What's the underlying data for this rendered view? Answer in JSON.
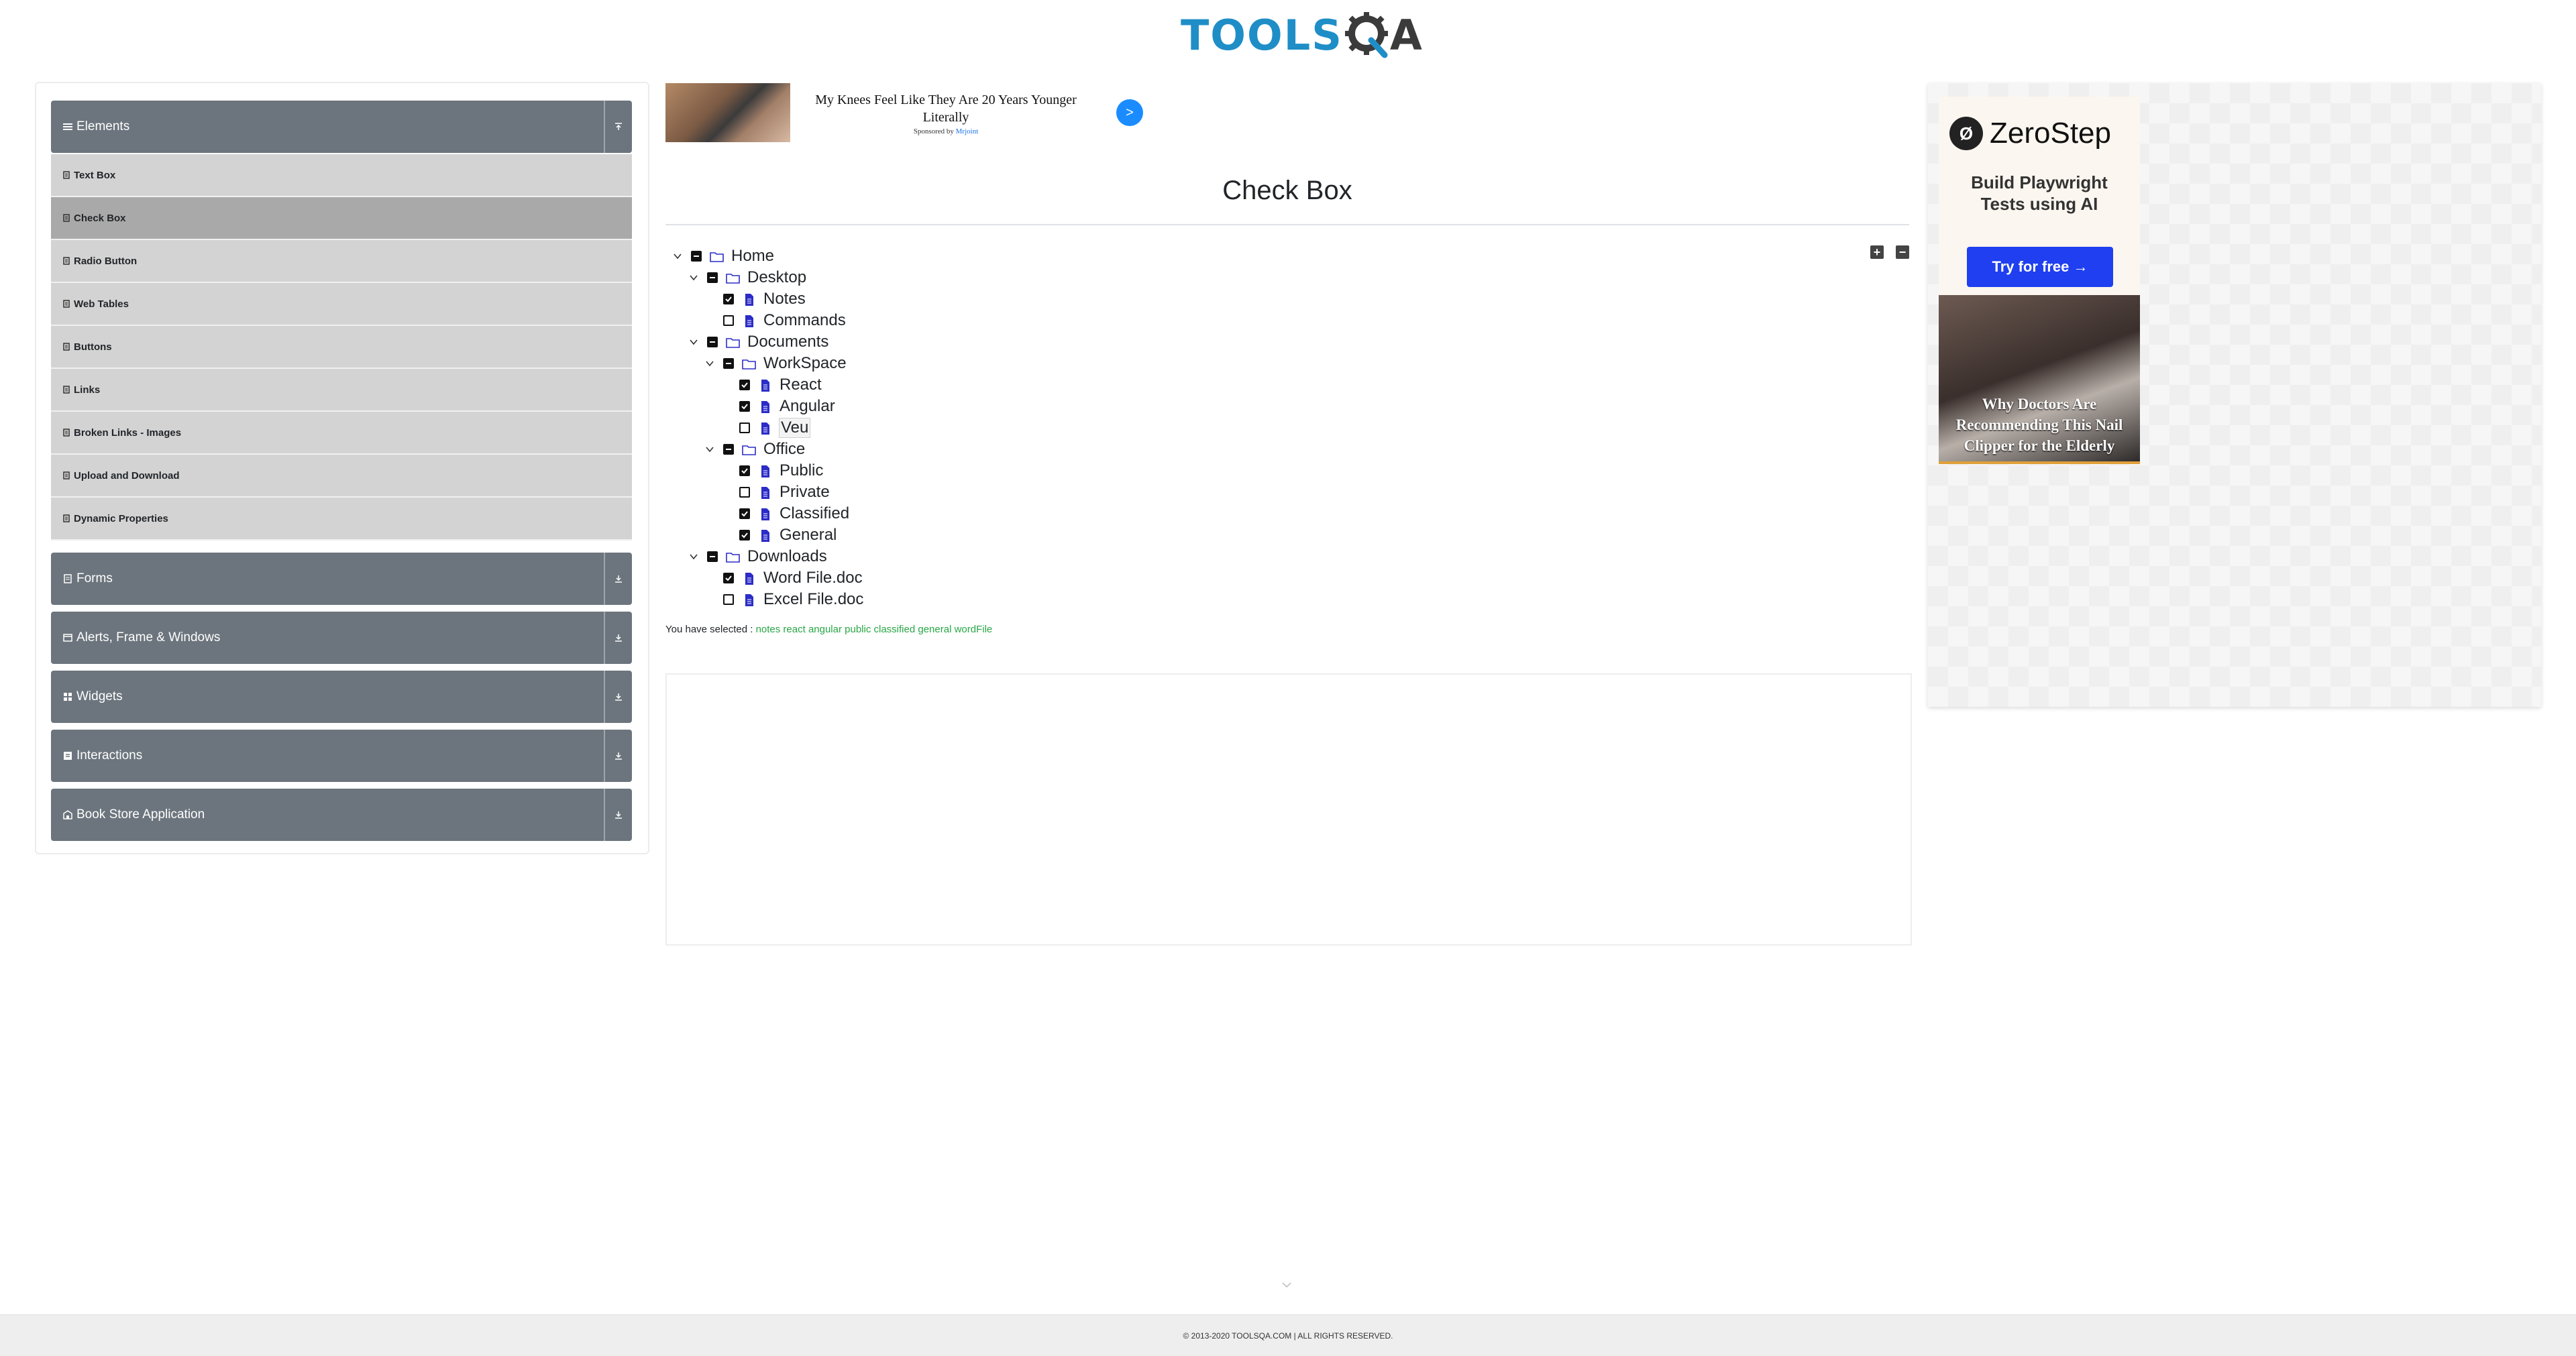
{
  "header": {
    "logo_tools": "TOOLS",
    "logo_qa": "A"
  },
  "sidebar": {
    "groups": [
      {
        "label": "Elements",
        "icon": "list-icon",
        "expanded": true
      },
      {
        "label": "Forms",
        "icon": "document-icon",
        "expanded": false
      },
      {
        "label": "Alerts, Frame & Windows",
        "icon": "window-icon",
        "expanded": false
      },
      {
        "label": "Widgets",
        "icon": "grid-icon",
        "expanded": false
      },
      {
        "label": "Interactions",
        "icon": "cursor-icon",
        "expanded": false
      },
      {
        "label": "Book Store Application",
        "icon": "bookstore-icon",
        "expanded": false
      }
    ],
    "items": [
      {
        "label": "Text Box"
      },
      {
        "label": "Check Box",
        "active": true
      },
      {
        "label": "Radio Button"
      },
      {
        "label": "Web Tables"
      },
      {
        "label": "Buttons"
      },
      {
        "label": "Links"
      },
      {
        "label": "Broken Links - Images"
      },
      {
        "label": "Upload and Download"
      },
      {
        "label": "Dynamic Properties"
      }
    ]
  },
  "ad_top": {
    "title": "My Knees Feel Like They Are 20 Years Younger Literally",
    "sponsored_prefix": "Sponsored by",
    "sponsor": "Mrjoint",
    "go": ">"
  },
  "main": {
    "title": "Check Box",
    "expand_all": "+",
    "collapse_all": "−",
    "result_prefix": "You have selected :",
    "result_values": "notes react angular public classified general wordFile"
  },
  "tree": [
    {
      "label": "Home",
      "type": "folder",
      "state": "half",
      "expanded": true
    },
    {
      "label": "Desktop",
      "type": "folder",
      "state": "half",
      "expanded": true
    },
    {
      "label": "Notes",
      "type": "file",
      "state": "checked"
    },
    {
      "label": "Commands",
      "type": "file",
      "state": "unchecked"
    },
    {
      "label": "Documents",
      "type": "folder",
      "state": "half",
      "expanded": true
    },
    {
      "label": "WorkSpace",
      "type": "folder",
      "state": "half",
      "expanded": true
    },
    {
      "label": "React",
      "type": "file",
      "state": "checked"
    },
    {
      "label": "Angular",
      "type": "file",
      "state": "checked"
    },
    {
      "label": "Veu",
      "type": "file",
      "state": "unchecked",
      "focused": true
    },
    {
      "label": "Office",
      "type": "folder",
      "state": "half",
      "expanded": true
    },
    {
      "label": "Public",
      "type": "file",
      "state": "checked"
    },
    {
      "label": "Private",
      "type": "file",
      "state": "unchecked"
    },
    {
      "label": "Classified",
      "type": "file",
      "state": "checked"
    },
    {
      "label": "General",
      "type": "file",
      "state": "checked"
    },
    {
      "label": "Downloads",
      "type": "folder",
      "state": "half",
      "expanded": true
    },
    {
      "label": "Word File.doc",
      "type": "file",
      "state": "checked"
    },
    {
      "label": "Excel File.doc",
      "type": "file",
      "state": "unchecked"
    }
  ],
  "right_ad": {
    "brand": "ZeroStep",
    "tagline_line1": "Build Playwright",
    "tagline_line2": "Tests using AI",
    "cta": "Try for free →",
    "caption_line1": "Why Doctors Are",
    "caption_line2": "Recommending This Nail",
    "caption_line3": "Clipper for the Elderly"
  },
  "footer": {
    "text": "© 2013-2020 TOOLSQA.COM | ALL RIGHTS RESERVED."
  },
  "colors": {
    "sidebar_header": "#6c757d",
    "sidebar_item": "#d3d3d3",
    "sidebar_item_active": "#a9a9a9",
    "result_green": "#28a745",
    "file_icon_blue": "#2c2cc8",
    "logo_blue": "#1f8ec7"
  }
}
